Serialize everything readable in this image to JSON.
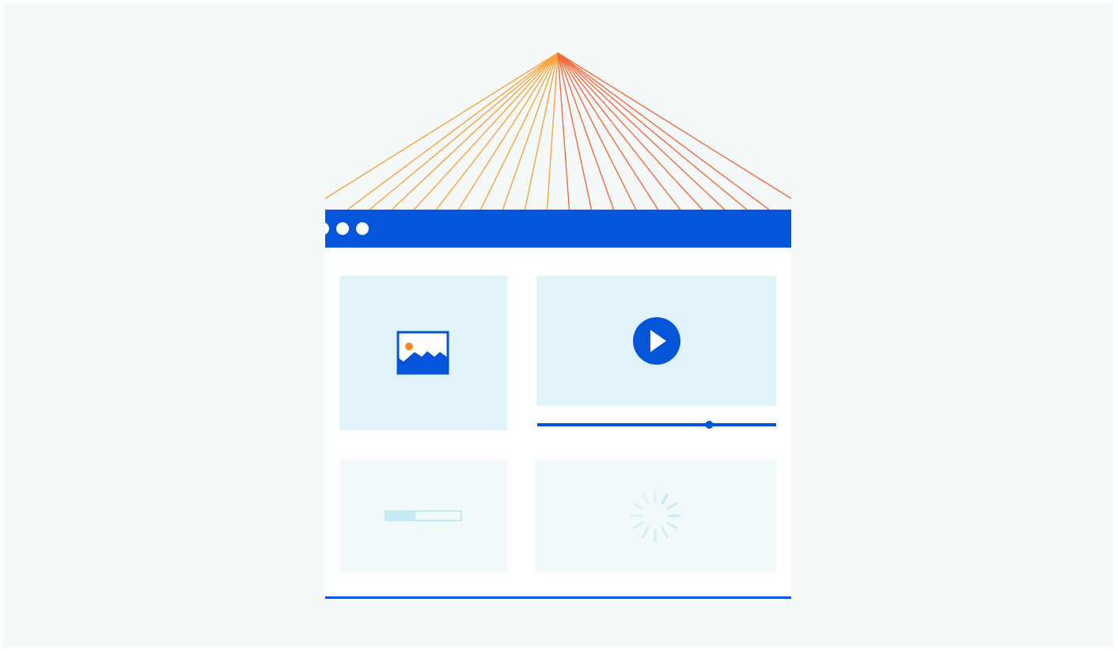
{
  "colors": {
    "page_background": "#F5F9F9",
    "outer_background": "#FFFFFF",
    "browser_bar": "#0455D9",
    "browser_body": "#FFFFFF",
    "window_dot": "#FFFFFF",
    "media_panel": "#E0F3F8",
    "placeholder_panel": "#F1F9FB",
    "accent": "#0455D9",
    "sun_dot": "#F38A2A",
    "ray_start": "#F8A33A",
    "ray_end": "#F26A3B",
    "loading_track": "#C6EAF4",
    "spinner": "#C6EAF4"
  },
  "browser": {
    "window_controls": [
      "dot",
      "dot",
      "dot"
    ]
  },
  "panels": {
    "image": {
      "icon": "image-icon"
    },
    "video": {
      "icon": "play-icon",
      "progress": 0.72
    },
    "loading_bar": {
      "icon": "loading-bar-icon",
      "progress": 0.4
    },
    "spinner": {
      "icon": "spinner-icon",
      "spokes": 12
    }
  },
  "rays": {
    "count": 22
  }
}
